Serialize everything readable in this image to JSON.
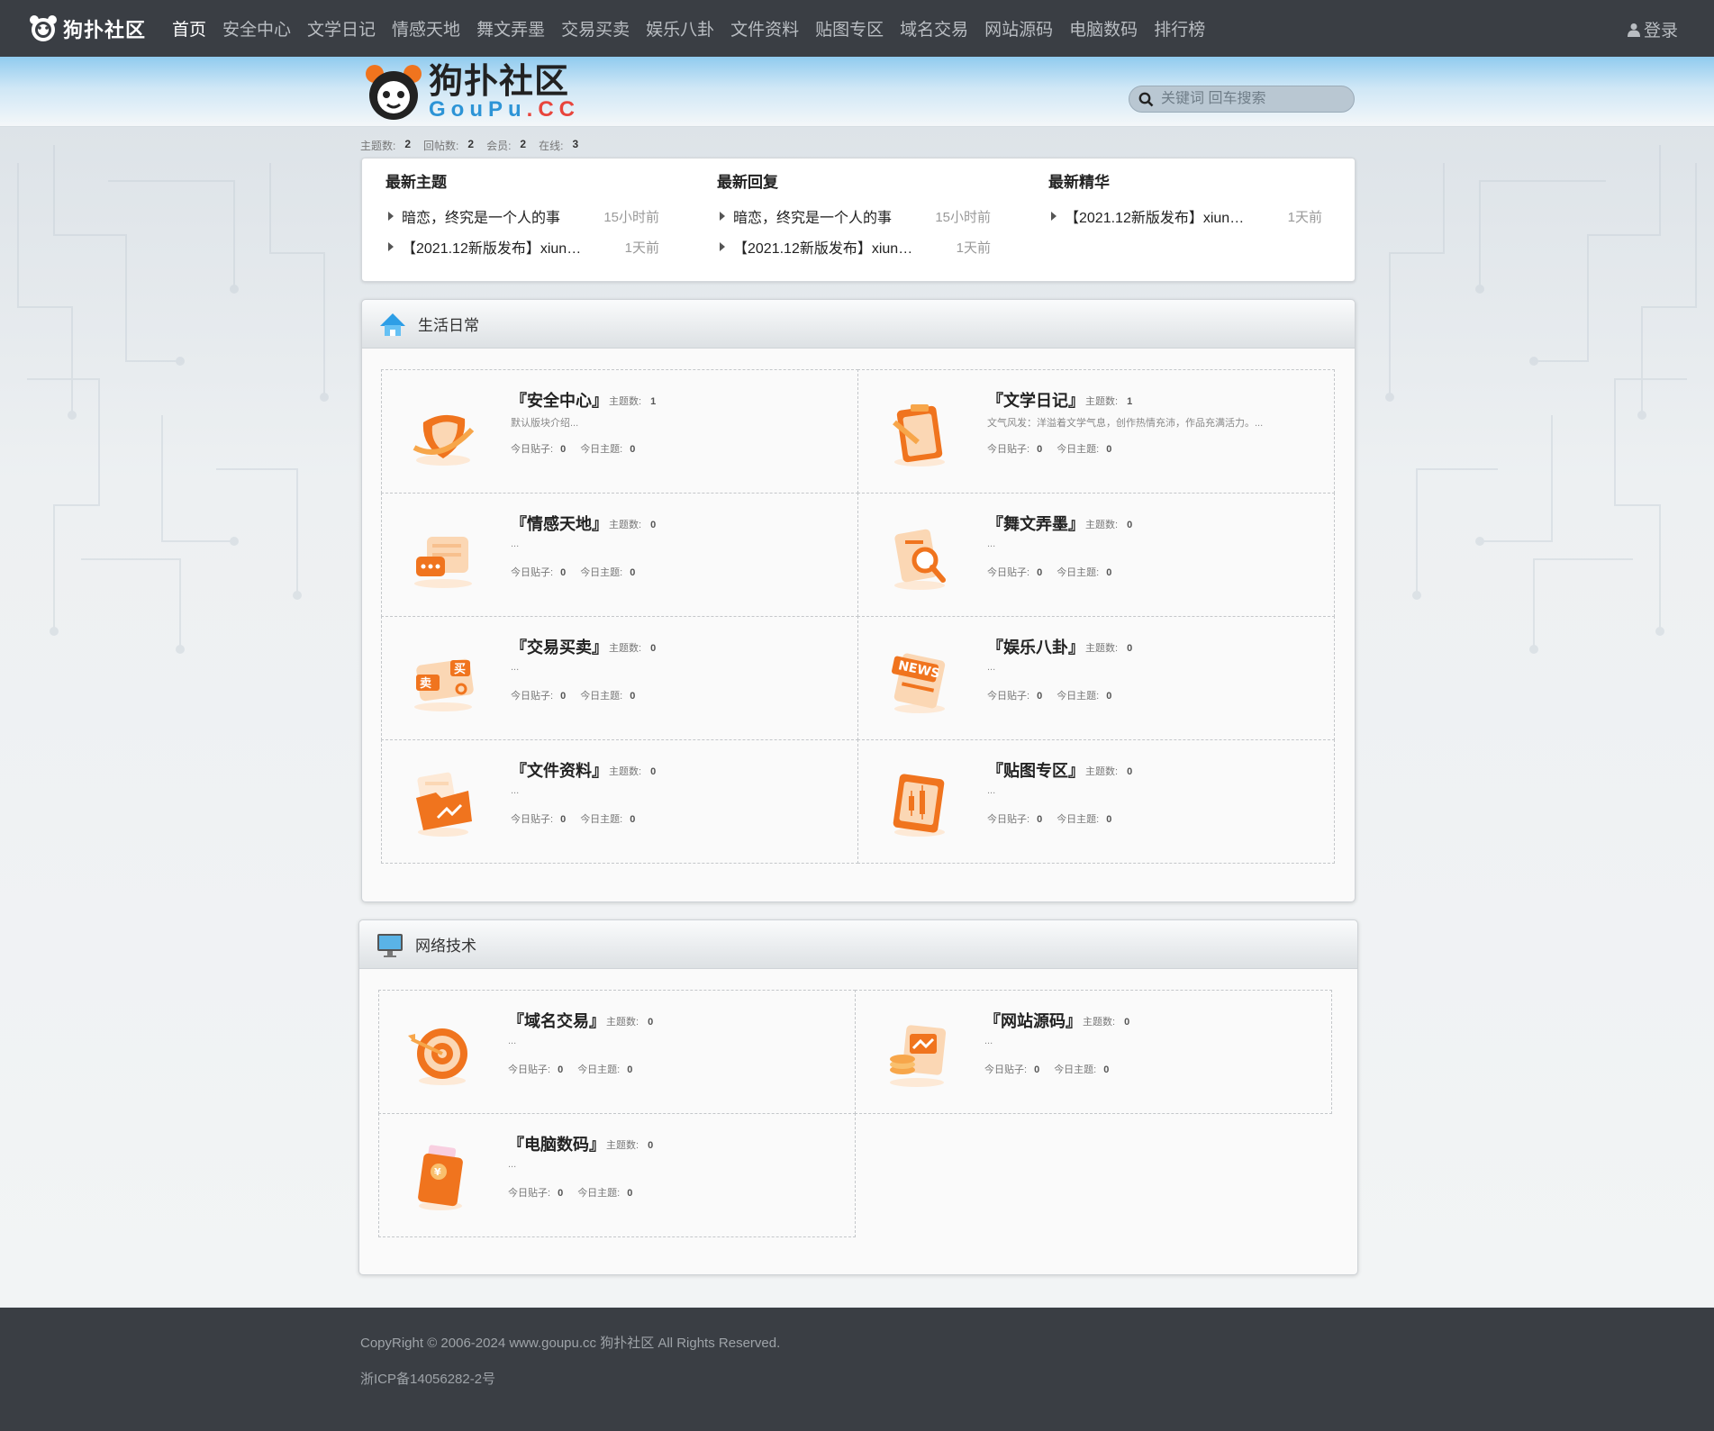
{
  "brand": {
    "small_logo_text": "狗扑社区",
    "big_logo_cn": "狗扑社区",
    "big_logo_en": "GouPu",
    "big_logo_suffix": ".CC"
  },
  "nav": {
    "items": [
      "首页",
      "安全中心",
      "文学日记",
      "情感天地",
      "舞文弄墨",
      "交易买卖",
      "娱乐八卦",
      "文件资料",
      "贴图专区",
      "域名交易",
      "网站源码",
      "电脑数码",
      "排行榜"
    ],
    "active": 0,
    "login": "登录"
  },
  "search": {
    "placeholder": "关键词 回车搜索"
  },
  "stats": {
    "topics_label": "主题数:",
    "topics": "2",
    "replies_label": "回帖数:",
    "replies": "2",
    "members_label": "会员:",
    "members": "2",
    "online_label": "在线:",
    "online": "3"
  },
  "latest": {
    "columns": [
      {
        "title": "最新主题",
        "items": [
          {
            "text": "暗恋，终究是一个人的事",
            "time": "15小时前"
          },
          {
            "text": "【2021.12新版发布】xiun…",
            "time": "1天前"
          }
        ]
      },
      {
        "title": "最新回复",
        "items": [
          {
            "text": "暗恋，终究是一个人的事",
            "time": "15小时前"
          },
          {
            "text": "【2021.12新版发布】xiun…",
            "time": "1天前"
          }
        ]
      },
      {
        "title": "最新精华",
        "items": [
          {
            "text": "【2021.12新版发布】xiun…",
            "time": "1天前"
          }
        ]
      }
    ]
  },
  "sections": [
    {
      "title": "生活日常",
      "icon": "house-icon",
      "forums": [
        {
          "name": "『安全中心』",
          "topics_label": "主题数:",
          "topics": "1",
          "desc": "默认版块介绍...",
          "today_posts_label": "今日贴子:",
          "today_posts": "0",
          "today_topics_label": "今日主题:",
          "today_topics": "0",
          "icon": "shield-icon"
        },
        {
          "name": "『文学日记』",
          "topics_label": "主题数:",
          "topics": "1",
          "desc": "文气风发：洋溢着文学气息，创作热情充沛，作品充满活力。...",
          "today_posts_label": "今日贴子:",
          "today_posts": "0",
          "today_topics_label": "今日主题:",
          "today_topics": "0",
          "icon": "clipboard-icon"
        },
        {
          "name": "『情感天地』",
          "topics_label": "主题数:",
          "topics": "0",
          "desc": "...",
          "today_posts_label": "今日贴子:",
          "today_posts": "0",
          "today_topics_label": "今日主题:",
          "today_topics": "0",
          "icon": "chat-icon"
        },
        {
          "name": "『舞文弄墨』",
          "topics_label": "主题数:",
          "topics": "0",
          "desc": "...",
          "today_posts_label": "今日贴子:",
          "today_posts": "0",
          "today_topics_label": "今日主题:",
          "today_topics": "0",
          "icon": "magnifier-doc-icon"
        },
        {
          "name": "『交易买卖』",
          "topics_label": "主题数:",
          "topics": "0",
          "desc": "...",
          "today_posts_label": "今日贴子:",
          "today_posts": "0",
          "today_topics_label": "今日主题:",
          "today_topics": "0",
          "icon": "trade-tag-icon"
        },
        {
          "name": "『娱乐八卦』",
          "topics_label": "主题数:",
          "topics": "0",
          "desc": "...",
          "today_posts_label": "今日贴子:",
          "today_posts": "0",
          "today_topics_label": "今日主题:",
          "today_topics": "0",
          "icon": "news-icon"
        },
        {
          "name": "『文件资料』",
          "topics_label": "主题数:",
          "topics": "0",
          "desc": "...",
          "today_posts_label": "今日贴子:",
          "today_posts": "0",
          "today_topics_label": "今日主题:",
          "today_topics": "0",
          "icon": "folder-icon"
        },
        {
          "name": "『贴图专区』",
          "topics_label": "主题数:",
          "topics": "0",
          "desc": "...",
          "today_posts_label": "今日贴子:",
          "today_posts": "0",
          "today_topics_label": "今日主题:",
          "today_topics": "0",
          "icon": "chart-board-icon"
        }
      ]
    },
    {
      "title": "网络技术",
      "icon": "monitor-icon",
      "forums": [
        {
          "name": "『域名交易』",
          "topics_label": "主题数:",
          "topics": "0",
          "desc": "...",
          "today_posts_label": "今日贴子:",
          "today_posts": "0",
          "today_topics_label": "今日主题:",
          "today_topics": "0",
          "icon": "target-icon"
        },
        {
          "name": "『网站源码』",
          "topics_label": "主题数:",
          "topics": "0",
          "desc": "...",
          "today_posts_label": "今日贴子:",
          "today_posts": "0",
          "today_topics_label": "今日主题:",
          "today_topics": "0",
          "icon": "coins-report-icon"
        },
        {
          "name": "『电脑数码』",
          "topics_label": "主题数:",
          "topics": "0",
          "desc": "...",
          "today_posts_label": "今日贴子:",
          "today_posts": "0",
          "today_topics_label": "今日主题:",
          "today_topics": "0",
          "icon": "red-envelope-icon"
        }
      ]
    }
  ],
  "footer": {
    "copyright": "CopyRight © 2006-2024 www.goupu.cc 狗扑社区 All Rights Reserved.",
    "icp": "浙ICP备14056282-2号"
  },
  "colors": {
    "topbar": "#3a3e44",
    "accent_orange": "#f0741e",
    "link_blue": "#2d94d6"
  }
}
